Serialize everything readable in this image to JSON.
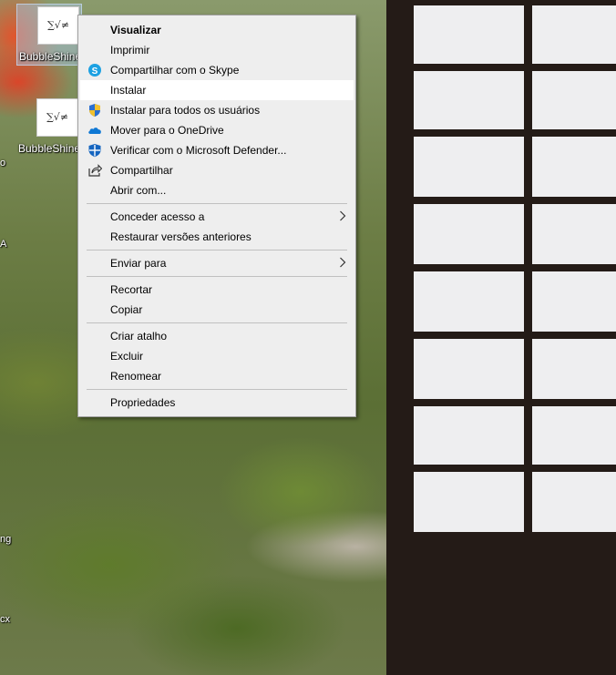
{
  "desktop": {
    "icons": [
      {
        "glyph": "∑√≠",
        "label": "BubbleShine"
      },
      {
        "glyph": "∑√≠",
        "label": "BubbleShine"
      }
    ],
    "edge_labels": [
      "o",
      "A",
      "ng",
      "cx"
    ]
  },
  "context_menu": {
    "items": [
      {
        "label": "Visualizar",
        "bold": true,
        "icon": null
      },
      {
        "label": "Imprimir",
        "icon": null
      },
      {
        "label": "Compartilhar com o Skype",
        "icon": "skype-icon"
      },
      {
        "label": "Instalar",
        "icon": null,
        "highlighted": true
      },
      {
        "label": "Instalar para todos os usuários",
        "icon": "uac-shield-icon"
      },
      {
        "label": "Mover para o OneDrive",
        "icon": "onedrive-icon"
      },
      {
        "label": "Verificar com o Microsoft Defender...",
        "icon": "defender-icon"
      },
      {
        "label": "Compartilhar",
        "icon": "share-icon"
      },
      {
        "label": "Abrir com...",
        "icon": null
      },
      {
        "label": "Conceder acesso a",
        "icon": null,
        "submenu": true
      },
      {
        "label": "Restaurar versões anteriores",
        "icon": null
      },
      {
        "label": "Enviar para",
        "icon": null,
        "submenu": true
      },
      {
        "label": "Recortar",
        "icon": null
      },
      {
        "label": "Copiar",
        "icon": null
      },
      {
        "label": "Criar atalho",
        "icon": null
      },
      {
        "label": "Excluir",
        "icon": null
      },
      {
        "label": "Renomear",
        "icon": null
      },
      {
        "label": "Propriedades",
        "icon": null
      }
    ]
  },
  "colors": {
    "menu_bg": "#eeeeee",
    "hover_bg": "#ffffff",
    "skype": "#1da1e2",
    "onedrive": "#0f78d4",
    "defender": "#1565c0"
  }
}
